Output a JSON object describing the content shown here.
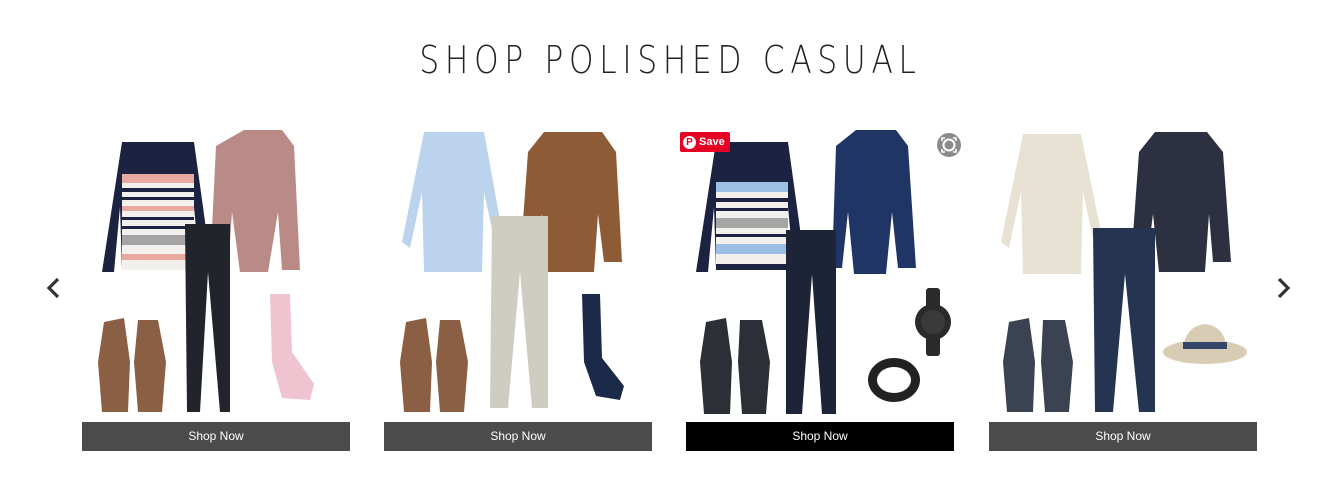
{
  "section": {
    "title": "SHOP POLISHED CASUAL"
  },
  "carousel": {
    "prev_icon": "chevron-left-icon",
    "next_icon": "chevron-right-icon",
    "cards": [
      {
        "button_label": "Shop Now",
        "colors": {
          "sweater_band": "#e7a9a0",
          "jacket": "#b98a86",
          "socks": "#efc3cf"
        }
      },
      {
        "button_label": "Shop Now",
        "colors": {
          "shirt": "#bcd3ee",
          "jacket": "#8e5b37",
          "pants": "#cfccc2"
        }
      },
      {
        "button_label": "Shop Now",
        "pin_label": "Save",
        "colors": {
          "sweater_band": "#9cbfe6",
          "jacket": "#1f3566"
        }
      },
      {
        "button_label": "Shop Now",
        "colors": {
          "shirt": "#e8e2d4",
          "jacket": "#2d3040",
          "hat": "#d9ccb4"
        }
      }
    ]
  },
  "colors": {
    "button": "#4b4b4b",
    "button_active": "#000000",
    "pinterest": "#e60023"
  }
}
